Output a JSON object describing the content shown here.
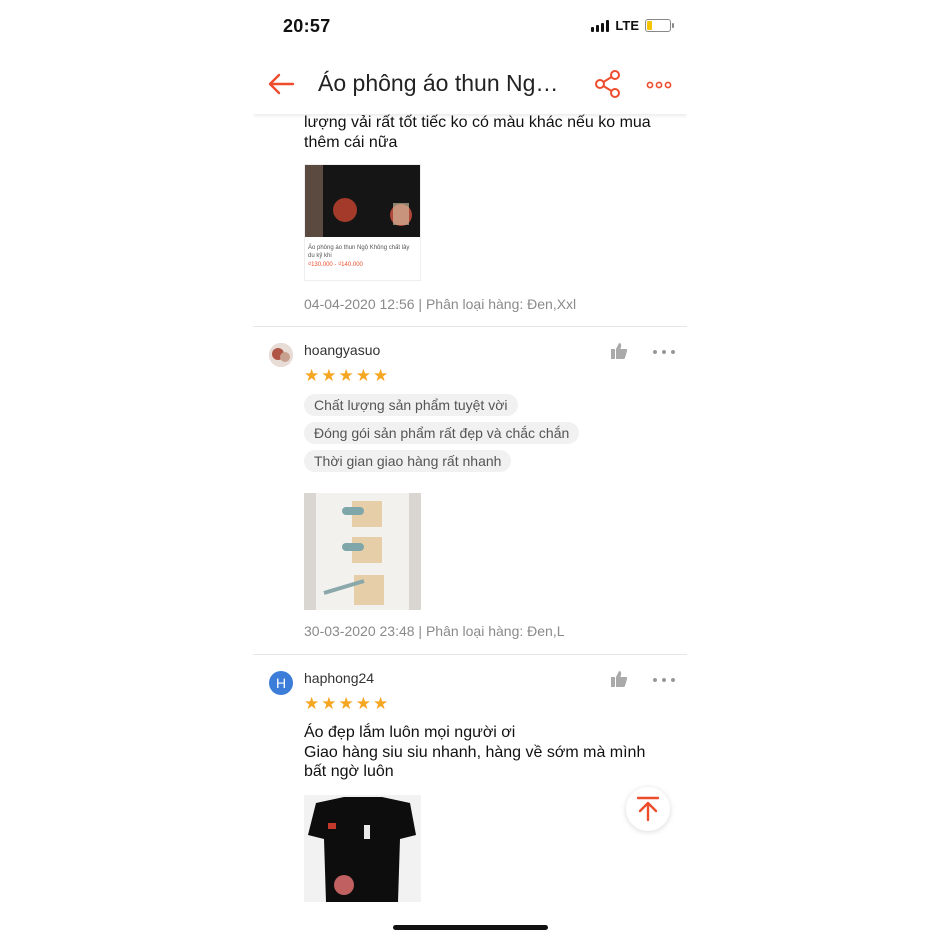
{
  "status_bar": {
    "time": "20:57",
    "network": "LTE",
    "battery_level": 0.25
  },
  "header": {
    "title": "Áo phông áo thun  Ng…",
    "back_icon": "arrow-left-icon",
    "share_icon": "share-icon",
    "more_icon": "more-dots-icon"
  },
  "colors": {
    "accent": "#ee4d2d",
    "star": "#f5a623",
    "meta": "#8a8a8a"
  },
  "reviews": [
    {
      "text_lines": [
        "lượng vải rất tốt tiếc ko có màu khác nếu ko mua",
        "thêm cái nữa"
      ],
      "thumb_caption": "Áo phông áo thun  Ngộ Không chất lây du kỹ khi",
      "thumb_price": "₫130.000 - ₫140.000",
      "meta": "04-04-2020 12:56 | Phân loại hàng: Đen,Xxl"
    },
    {
      "username": "hoangyasuo",
      "rating": 5,
      "tags": [
        "Chất lượng sản phẩm tuyệt vời",
        "Đóng gói sản phẩm rất đẹp và chắc chắn",
        "Thời gian giao hàng rất nhanh"
      ],
      "meta": "30-03-2020 23:48 | Phân loại hàng: Đen,L"
    },
    {
      "username": "haphong24",
      "avatar_letter": "H",
      "rating": 5,
      "text_lines": [
        "Áo đẹp lắm luôn mọi người ơi",
        "Giao hàng siu siu nhanh, hàng về sớm mà mình",
        "bất ngờ luôn"
      ]
    }
  ],
  "icons": {
    "like": "thumbs-up-icon",
    "scroll_top": "arrow-up-icon"
  }
}
